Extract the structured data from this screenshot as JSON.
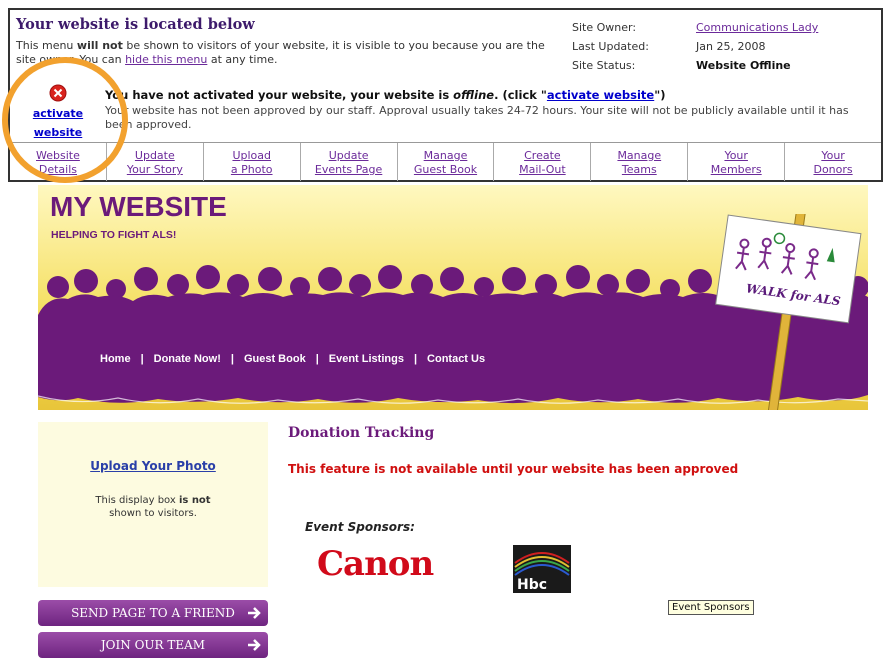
{
  "admin": {
    "title": "Your website is located below",
    "text_1": "This menu ",
    "text_bold": "will not",
    "text_2": " be shown to visitors of your website, it is visible to you because you are the site owner. You can ",
    "hide_link": "hide this menu",
    "text_3": " at any time.",
    "meta": {
      "owner_label": "Site Owner:",
      "owner_value": "Communications Lady",
      "updated_label": "Last Updated:",
      "updated_value": "Jan 25, 2008",
      "status_label": "Site Status:",
      "status_value": "Website Offline"
    },
    "activate_link": "activate website",
    "notice_1": "You have not activated your website, your website is ",
    "notice_italic": "offline",
    "notice_2": ". (click \"",
    "notice_link": "activate website",
    "notice_3": "\")",
    "notice_body": "Your website has not been approved by our staff. Approval usually takes 24-72 hours. Your site will not be publicly available until it has been approved.",
    "tabs": [
      {
        "line1": "Website",
        "line2": "Details"
      },
      {
        "line1": "Update",
        "line2": "Your Story"
      },
      {
        "line1": "Upload",
        "line2": "a Photo"
      },
      {
        "line1": "Update",
        "line2": "Events Page"
      },
      {
        "line1": "Manage",
        "line2": "Guest Book"
      },
      {
        "line1": "Create",
        "line2": "Mail-Out"
      },
      {
        "line1": "Manage",
        "line2": "Teams"
      },
      {
        "line1": "Your",
        "line2": "Members"
      },
      {
        "line1": "Your",
        "line2": "Donors"
      }
    ]
  },
  "banner": {
    "title": "MY WEBSITE",
    "tagline": "HELPING TO FIGHT ALS!",
    "sign_text": "WALK for ALS",
    "nav": [
      "Home",
      "Donate Now!",
      "Guest Book",
      "Event Listings",
      "Contact Us"
    ],
    "nav_sep": "|"
  },
  "sidebar": {
    "upload_link": "Upload Your Photo",
    "note_1": "This display box ",
    "note_bold_1": "is not",
    "note_2": " shown to visitors."
  },
  "buttons": {
    "send": "SEND PAGE TO A FRIEND",
    "join": "JOIN OUR TEAM"
  },
  "content": {
    "title": "Donation Tracking",
    "warning": "This feature is not available until your website has been approved",
    "sponsors_label": "Event Sponsors:",
    "canon": "Canon",
    "hbc": "Hbc",
    "tooltip": "Event Sponsors"
  },
  "colors": {
    "accent_orange": "#f2a12e",
    "brand_purple": "#6b1a7a",
    "warning_red": "#d01010"
  }
}
